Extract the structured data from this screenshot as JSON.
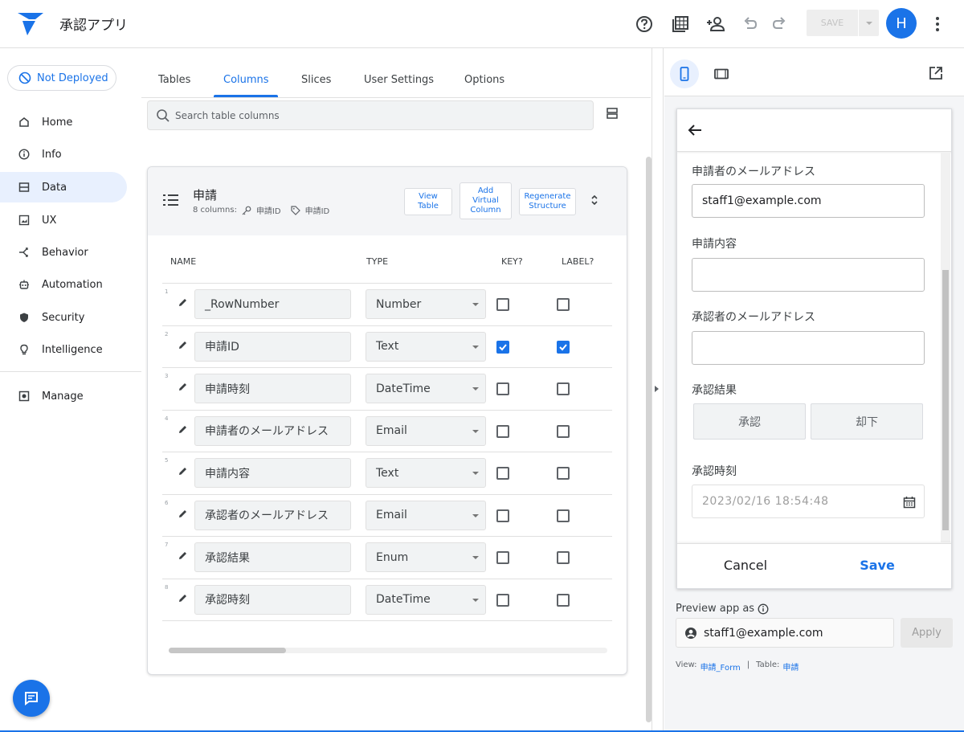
{
  "app": {
    "title": "承認アプリ",
    "save_label": "SAVE",
    "avatar_initial": "H"
  },
  "colors": {
    "accent": "#1a73e8",
    "active_nav_bg": "#e8f0fe",
    "header_bg": "#f4f5f7"
  },
  "nav": {
    "deploy_status": "Not Deployed",
    "items": [
      {
        "label": "Home",
        "icon": "home-icon"
      },
      {
        "label": "Info",
        "icon": "info-icon"
      },
      {
        "label": "Data",
        "icon": "data-icon",
        "active": true
      },
      {
        "label": "UX",
        "icon": "ux-icon"
      },
      {
        "label": "Behavior",
        "icon": "behavior-icon"
      },
      {
        "label": "Automation",
        "icon": "automation-icon"
      },
      {
        "label": "Security",
        "icon": "security-icon"
      },
      {
        "label": "Intelligence",
        "icon": "intelligence-icon"
      },
      {
        "label": "Manage",
        "icon": "manage-icon"
      }
    ]
  },
  "tabs": [
    {
      "label": "Tables"
    },
    {
      "label": "Columns",
      "active": true
    },
    {
      "label": "Slices"
    },
    {
      "label": "User Settings"
    },
    {
      "label": "Options"
    }
  ],
  "search": {
    "placeholder": "Search table columns"
  },
  "table": {
    "name": "申請",
    "column_count": "8 columns:",
    "key_column": "申請ID",
    "label_column": "申請ID",
    "buttons": {
      "view": "View Table",
      "add_virtual": "Add Virtual Column",
      "regenerate": "Regenerate Structure"
    },
    "headers": {
      "name": "NAME",
      "type": "TYPE",
      "key": "KEY?",
      "label": "LABEL?"
    },
    "rows": [
      {
        "num": "1",
        "name": "_RowNumber",
        "type": "Number",
        "key": false,
        "label": false
      },
      {
        "num": "2",
        "name": "申請ID",
        "type": "Text",
        "key": true,
        "label": true
      },
      {
        "num": "3",
        "name": "申請時刻",
        "type": "DateTime",
        "key": false,
        "label": false
      },
      {
        "num": "4",
        "name": "申請者のメールアドレス",
        "type": "Email",
        "key": false,
        "label": false
      },
      {
        "num": "5",
        "name": "申請内容",
        "type": "Text",
        "key": false,
        "label": false
      },
      {
        "num": "6",
        "name": "承認者のメールアドレス",
        "type": "Email",
        "key": false,
        "label": false
      },
      {
        "num": "7",
        "name": "承認結果",
        "type": "Enum",
        "key": false,
        "label": false
      },
      {
        "num": "8",
        "name": "承認時刻",
        "type": "DateTime",
        "key": false,
        "label": false
      }
    ]
  },
  "preview": {
    "fields": [
      {
        "label": "申請者のメールアドレス",
        "value": "staff1@example.com"
      },
      {
        "label": "申請内容",
        "value": ""
      },
      {
        "label": "承認者のメールアドレス",
        "value": ""
      },
      {
        "label": "承認結果"
      },
      {
        "label": "承認時刻",
        "value": "2023/02/16 18:54:48"
      }
    ],
    "enum_options": [
      "承認",
      "却下"
    ],
    "cancel_label": "Cancel",
    "save_label": "Save",
    "preview_as_label": "Preview app as",
    "preview_user": "staff1@example.com",
    "apply_label": "Apply",
    "view_prefix": "View:",
    "view_name": "申請_Form",
    "separator": "|",
    "table_prefix": "Table:",
    "table_name": "申請"
  }
}
